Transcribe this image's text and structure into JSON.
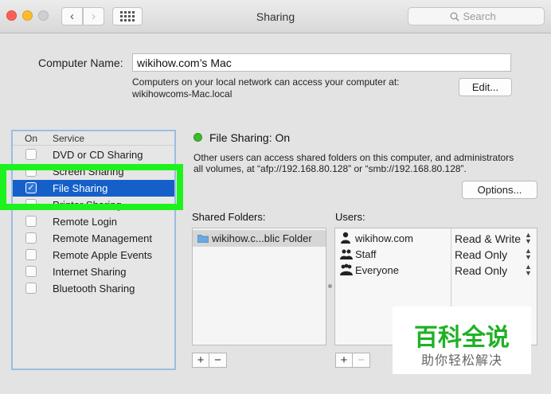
{
  "window": {
    "title": "Sharing",
    "search_placeholder": "Search"
  },
  "computer_name": {
    "label": "Computer Name:",
    "value": "wikihow.com’s Mac",
    "description_line1": "Computers on your local network can access your computer at:",
    "description_line2": "wikihowcoms-Mac.local",
    "edit_label": "Edit..."
  },
  "services": {
    "header_on": "On",
    "header_service": "Service",
    "items": [
      {
        "label": "DVD or CD Sharing",
        "checked": false
      },
      {
        "label": "Screen Sharing",
        "checked": false
      },
      {
        "label": "File Sharing",
        "checked": true,
        "selected": true
      },
      {
        "label": "Printer Sharing",
        "checked": false
      },
      {
        "label": "Remote Login",
        "checked": false
      },
      {
        "label": "Remote Management",
        "checked": false
      },
      {
        "label": "Remote Apple Events",
        "checked": false
      },
      {
        "label": "Internet Sharing",
        "checked": false
      },
      {
        "label": "Bluetooth Sharing",
        "checked": false
      }
    ]
  },
  "file_sharing": {
    "status": "File Sharing: On",
    "status_color": "#3fb92e",
    "description_line1": "Other users can access shared folders on this computer, and administrators",
    "description_line2": "all volumes, at “afp://192.168.80.128” or “smb://192.168.80.128”.",
    "options_label": "Options...",
    "shared_folders_label": "Shared Folders:",
    "folders": [
      "wikihow.c...blic Folder"
    ],
    "users_label": "Users:",
    "users": [
      {
        "name": "wikihow.com",
        "permission": "Read & Write",
        "icon": "single-user-icon"
      },
      {
        "name": "Staff",
        "permission": "Read Only",
        "icon": "group-icon"
      },
      {
        "name": "Everyone",
        "permission": "Read Only",
        "icon": "group-icon"
      }
    ]
  },
  "controls": {
    "add": "+",
    "remove": "−"
  },
  "watermark": {
    "big": "百科全说",
    "small": "助你轻松解决",
    "color": "#1fb125"
  },
  "colors": {
    "selection": "#1460c8",
    "highlight": "#1ef21e"
  }
}
